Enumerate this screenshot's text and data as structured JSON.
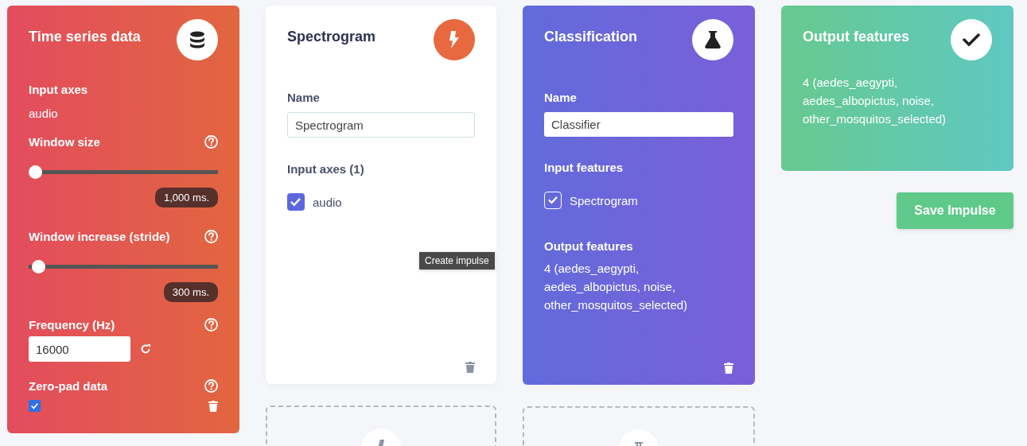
{
  "time_series": {
    "title": "Time series data",
    "input_axes_label": "Input axes",
    "input_axes_value": "audio",
    "sliders": [
      {
        "label": "Window size",
        "level": 0.0,
        "reading": "1,000 ms."
      },
      {
        "label": "Window increase (stride)",
        "level": 0.02,
        "reading": "300 ms."
      }
    ],
    "frequency": {
      "label": "Frequency (Hz)",
      "value": "16000"
    },
    "zero_pad": {
      "label": "Zero-pad data",
      "checked": true
    }
  },
  "spectrogram": {
    "title": "Spectrogram",
    "name_label": "Name",
    "name_value": "Spectrogram",
    "axes_label": "Input axes (1)",
    "axes": [
      {
        "label": "audio",
        "checked": true
      }
    ]
  },
  "tooltip": "Create impulse",
  "classification": {
    "title": "Classification",
    "name_label": "Name",
    "name_value": "Classifier",
    "inputs_label": "Input features",
    "inputs": [
      {
        "label": "Spectrogram",
        "checked": true
      }
    ],
    "outputs_label": "Output features",
    "outputs_text": "4 (aedes_aegypti, aedes_albopictus, noise, other_mosquitos_selected)"
  },
  "output": {
    "title": "Output features",
    "text": "4 (aedes_aegypti, aedes_albopictus, noise, other_mosquitos_selected)"
  },
  "save_button": "Save Impulse",
  "add_blocks": [
    {
      "kind": "processing"
    },
    {
      "kind": "learning"
    }
  ]
}
